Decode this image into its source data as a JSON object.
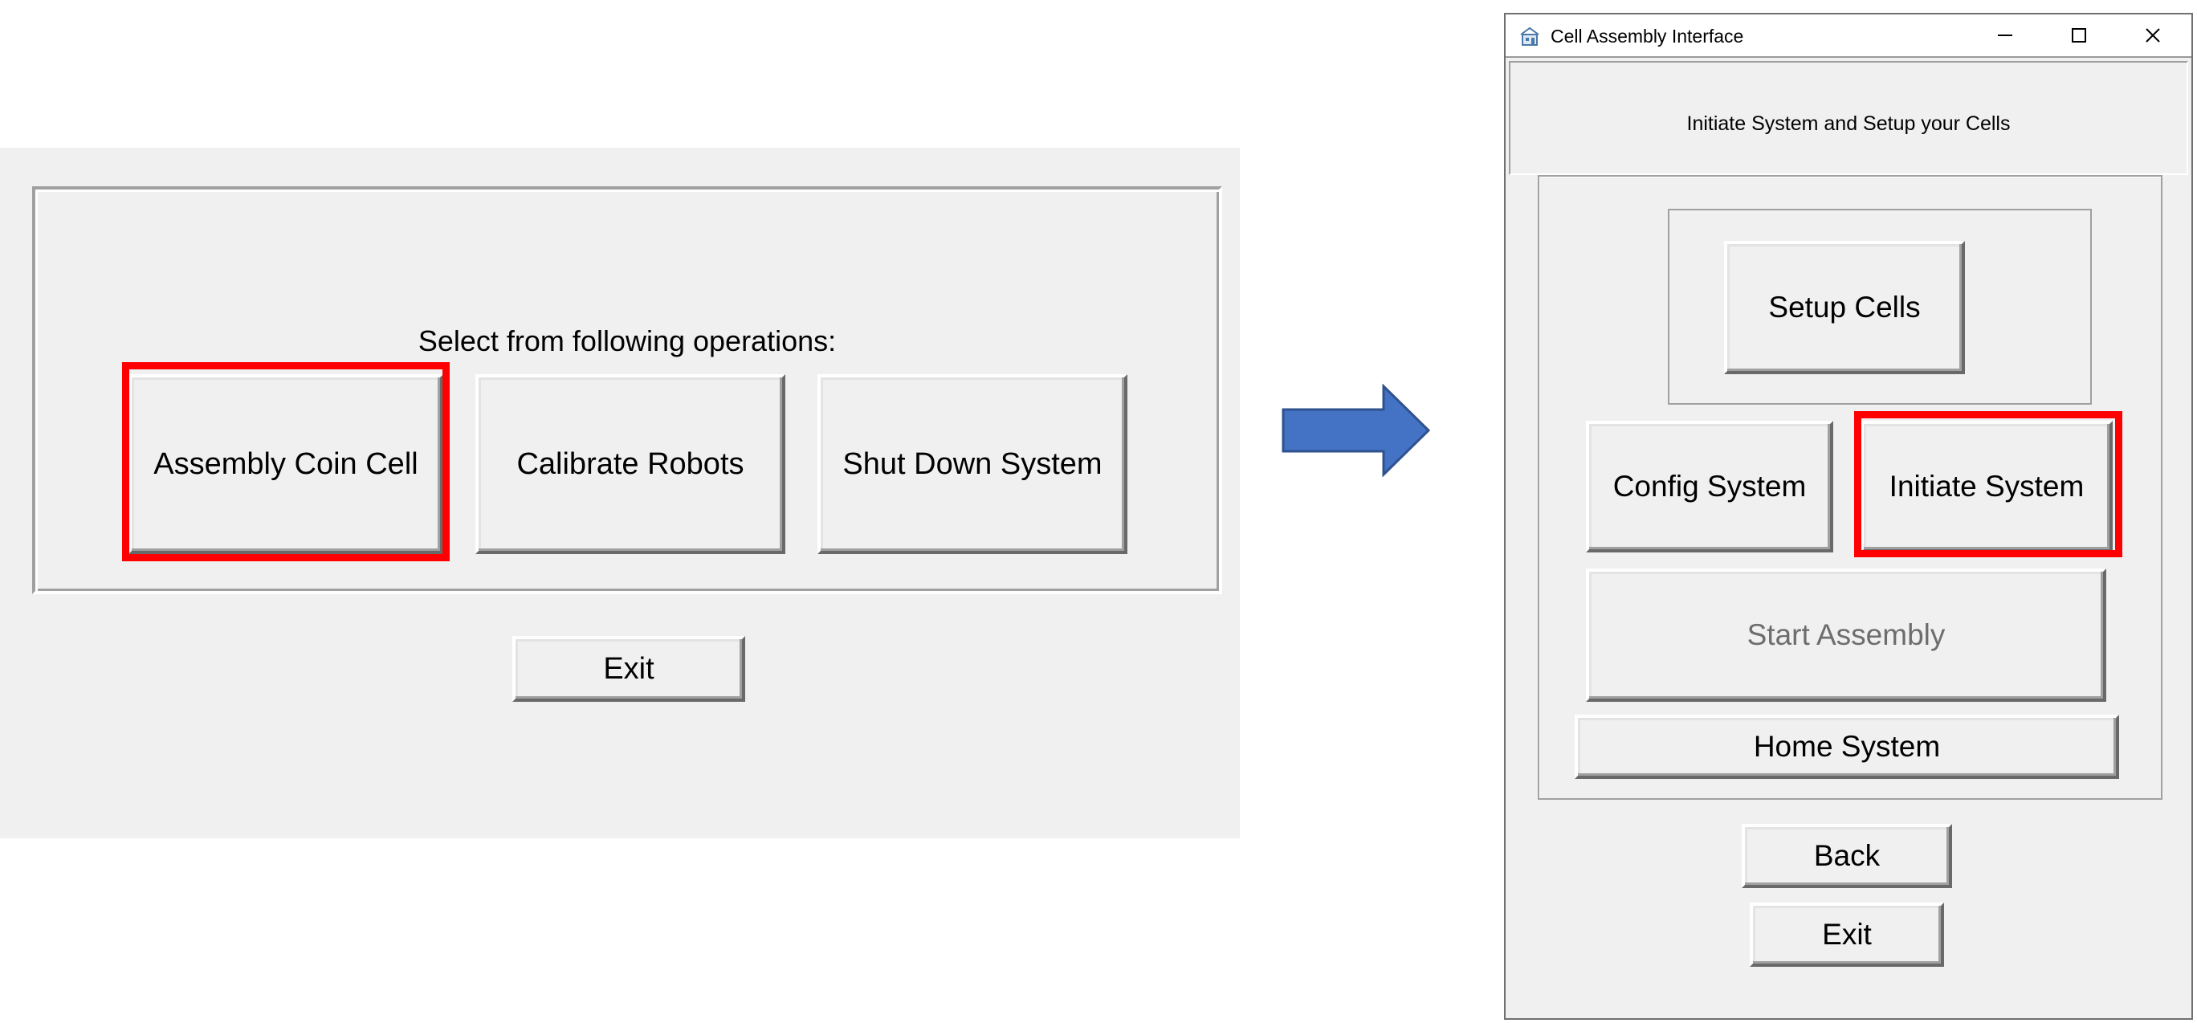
{
  "left_panel": {
    "prompt": "Select from following operations:",
    "buttons": {
      "assembly_coin_cell": "Assembly Coin Cell",
      "calibrate_robots": "Calibrate Robots",
      "shut_down_system": "Shut Down System",
      "exit": "Exit"
    }
  },
  "window": {
    "title": "Cell Assembly Interface",
    "header": "Initiate System and Setup your Cells",
    "buttons": {
      "setup_cells": "Setup Cells",
      "config_system": "Config System",
      "initiate_system": "Initiate System",
      "start_assembly": "Start Assembly",
      "home_system": "Home System",
      "back": "Back",
      "exit": "Exit"
    },
    "start_assembly_enabled": false
  },
  "colors": {
    "highlight": "#ff0000",
    "arrow_fill": "#4472c4",
    "arrow_stroke": "#2f528f",
    "panel_bg": "#f0f0f0"
  },
  "icons": {
    "app": "app-icon",
    "minimize": "minimize-icon",
    "maximize": "maximize-icon",
    "close": "close-icon",
    "arrow": "right-arrow-icon"
  }
}
